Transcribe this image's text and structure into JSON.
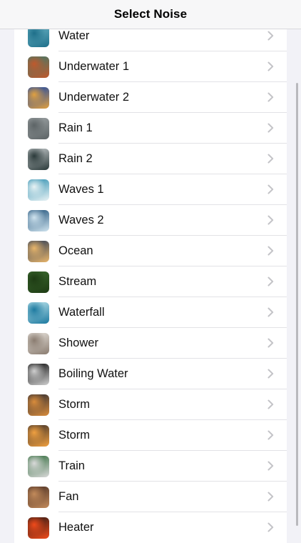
{
  "header": {
    "title": "Select Noise"
  },
  "items": [
    {
      "label": "Water",
      "thumb": [
        "#6fb8c9",
        "#1e6f8a"
      ]
    },
    {
      "label": "Underwater 1",
      "thumb": [
        "#3f7a6a",
        "#c0592c"
      ]
    },
    {
      "label": "Underwater 2",
      "thumb": [
        "#1746a8",
        "#e0a040"
      ]
    },
    {
      "label": "Rain 1",
      "thumb": [
        "#9ea4a6",
        "#5d6466"
      ]
    },
    {
      "label": "Rain 2",
      "thumb": [
        "#c7ccce",
        "#2b3a3a"
      ]
    },
    {
      "label": "Waves 1",
      "thumb": [
        "#2e8fb0",
        "#e8f2f4"
      ]
    },
    {
      "label": "Waves 2",
      "thumb": [
        "#1d4f78",
        "#cfe3ee"
      ]
    },
    {
      "label": "Ocean",
      "thumb": [
        "#2a3a55",
        "#e8b56a"
      ]
    },
    {
      "label": "Stream",
      "thumb": [
        "#3b6a2e",
        "#1e3b14"
      ]
    },
    {
      "label": "Waterfall",
      "thumb": [
        "#bfe6ee",
        "#1d7aa0"
      ]
    },
    {
      "label": "Shower",
      "thumb": [
        "#e9e5df",
        "#8a7c70"
      ]
    },
    {
      "label": "Boiling Water",
      "thumb": [
        "#0a0a0a",
        "#cfcfcf"
      ]
    },
    {
      "label": "Storm",
      "thumb": [
        "#2a2a33",
        "#d98c3b"
      ]
    },
    {
      "label": "Storm",
      "thumb": [
        "#3a2f2a",
        "#f0a040"
      ]
    },
    {
      "label": "Train",
      "thumb": [
        "#2f6a3a",
        "#d9d9d9"
      ]
    },
    {
      "label": "Fan",
      "thumb": [
        "#4a2f24",
        "#c28a5a"
      ]
    },
    {
      "label": "Heater",
      "thumb": [
        "#2b1a16",
        "#f04a1a"
      ]
    }
  ]
}
